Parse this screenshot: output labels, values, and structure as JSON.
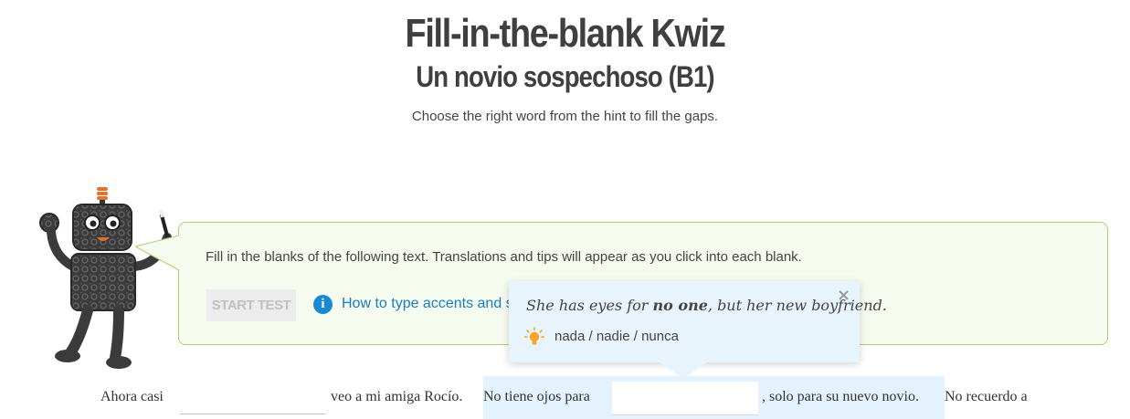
{
  "header": {
    "title": "Fill-in-the-blank Kwiz",
    "subtitle": "Un novio sospechoso (B1)",
    "instructions": "Choose the right word from the hint to fill the gaps."
  },
  "bubble": {
    "text": "Fill in the blanks of the following text. Translations and tips will appear as you click into each blank.",
    "start_label": "START TEST",
    "info_icon": "i",
    "accents_link": "How to type accents and s"
  },
  "tooltip": {
    "translation_pre": "She has eyes for ",
    "translation_bold": "no one",
    "translation_post": ", but her new boyfriend.",
    "hint": "nada / nadie / nunca",
    "close_symbol": "×"
  },
  "exercise": {
    "seg1": "Ahora casi",
    "seg2": "veo a mi amiga Rocío.",
    "seg3": "No tiene ojos para",
    "seg4": ", solo para su nuevo novio.",
    "seg5": "No recuerdo a",
    "blank1_value": "",
    "blank2_value": ""
  },
  "colors": {
    "bubble_bg": "#f5fbee",
    "bubble_border": "#a9d46e",
    "link": "#1a7cc1",
    "tooltip_bg": "#e8f4fc",
    "highlight": "#e3f2fc",
    "bulb": "#f5a623"
  }
}
